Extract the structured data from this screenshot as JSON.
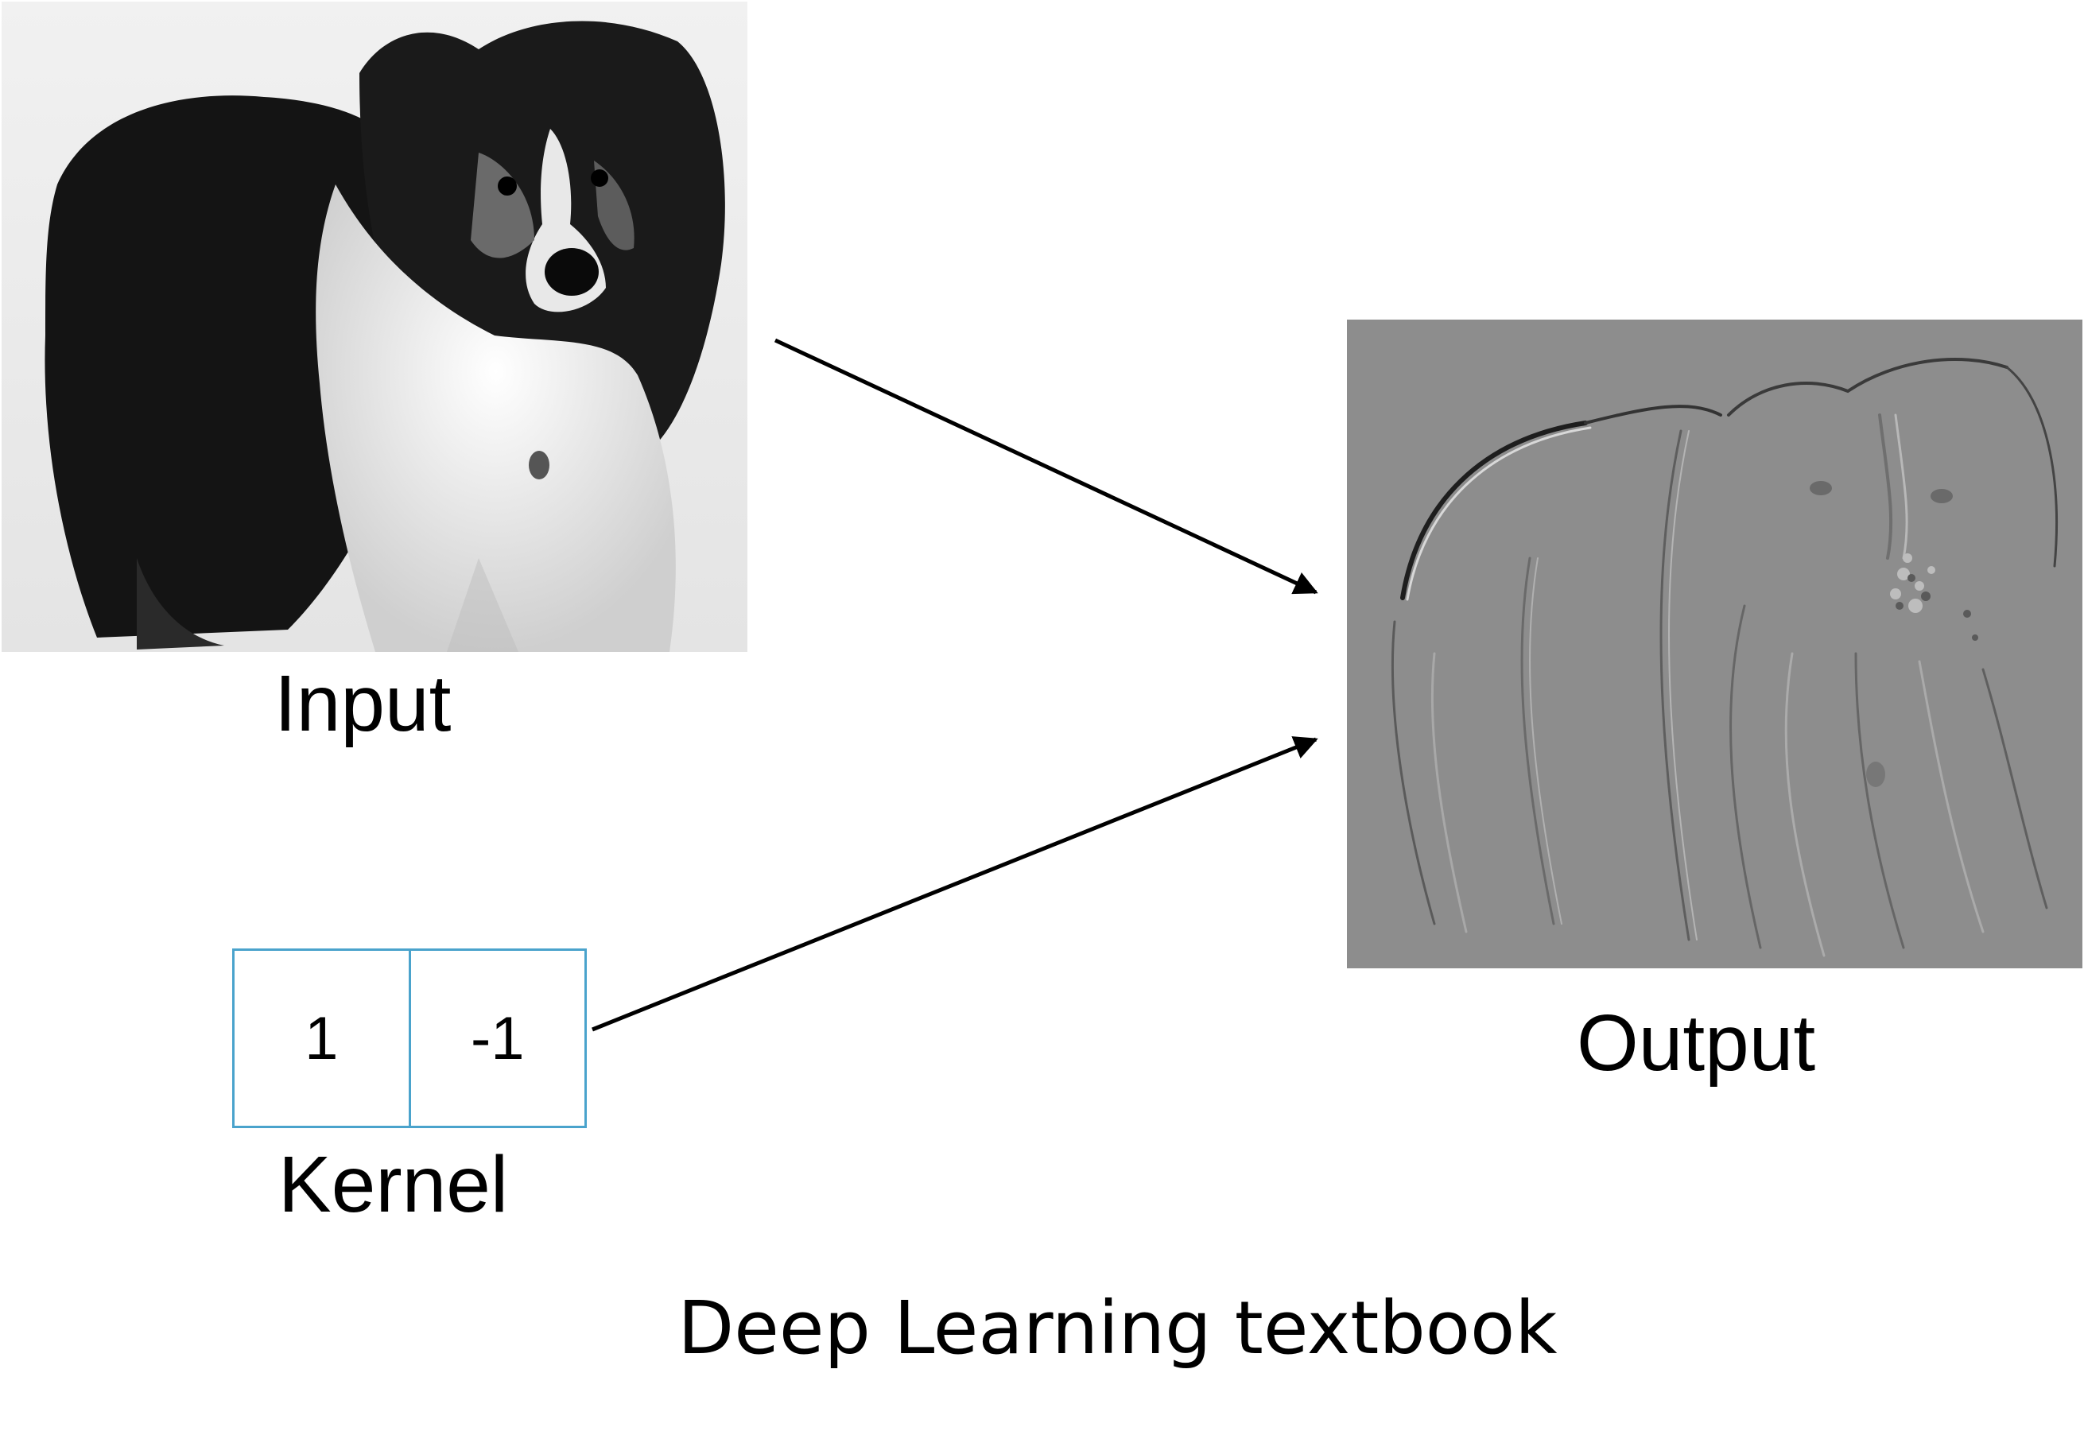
{
  "diagram": {
    "input": {
      "label": "Input"
    },
    "kernel": {
      "label": "Kernel",
      "values": [
        "1",
        "-1"
      ],
      "border_color": "#4aa3cc"
    },
    "output": {
      "label": "Output"
    },
    "caption": "Deep Learning textbook"
  }
}
